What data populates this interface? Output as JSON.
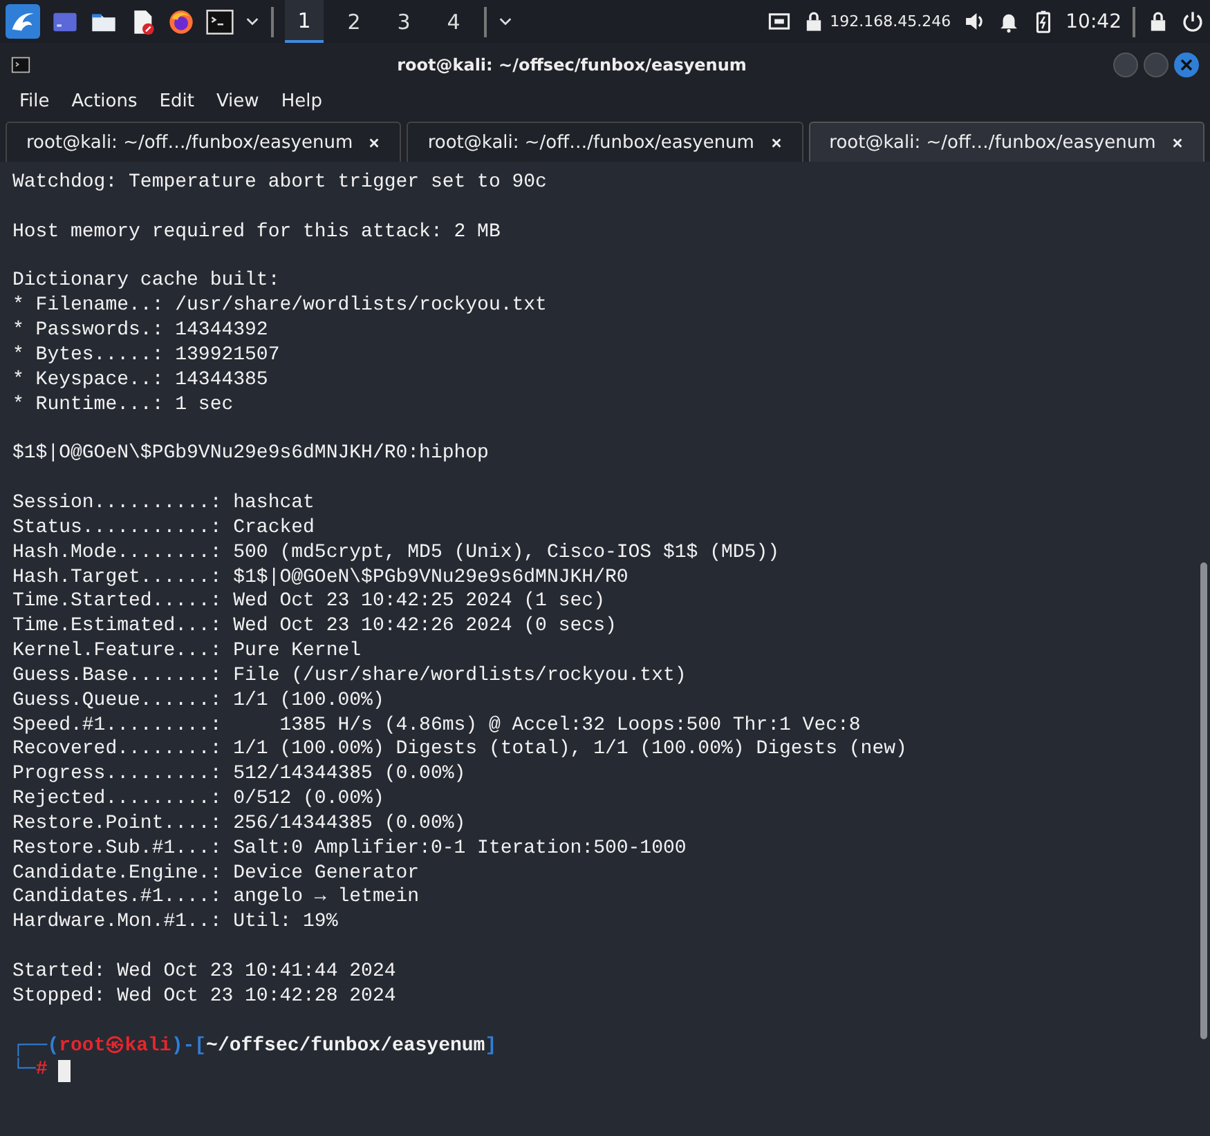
{
  "taskbar": {
    "launchers": [
      {
        "kind": "kali"
      },
      {
        "kind": "desktop"
      },
      {
        "kind": "folder"
      },
      {
        "kind": "editor"
      },
      {
        "kind": "browser"
      },
      {
        "kind": "terminal"
      },
      {
        "kind": "chevron"
      }
    ],
    "workspaces": [
      {
        "label": "1",
        "selected": true
      },
      {
        "label": "2",
        "selected": false
      },
      {
        "label": "3",
        "selected": false
      },
      {
        "label": "4",
        "selected": false
      }
    ],
    "ip": "192.168.45.246",
    "clock": "10:42"
  },
  "window": {
    "title": "root@kali: ~/offsec/funbox/easyenum"
  },
  "menu": [
    "File",
    "Actions",
    "Edit",
    "View",
    "Help"
  ],
  "tabs": [
    {
      "label": "root@kali: ~/off…/funbox/easyenum",
      "selected": false
    },
    {
      "label": "root@kali: ~/off…/funbox/easyenum",
      "selected": false
    },
    {
      "label": "root@kali: ~/off…/funbox/easyenum",
      "selected": true
    }
  ],
  "terminal": {
    "blocks": [
      [
        "Watchdog: Temperature abort trigger set to 90c"
      ],
      [
        "Host memory required for this attack: 2 MB"
      ],
      [
        "Dictionary cache built:",
        "* Filename..: /usr/share/wordlists/rockyou.txt",
        "* Passwords.: 14344392",
        "* Bytes.....: 139921507",
        "* Keyspace..: 14344385",
        "* Runtime...: 1 sec"
      ],
      [
        "$1$|O@GOeN\\$PGb9VNu29e9s6dMNJKH/R0:hiphop"
      ],
      [
        "Session..........: hashcat",
        "Status...........: Cracked",
        "Hash.Mode........: 500 (md5crypt, MD5 (Unix), Cisco-IOS $1$ (MD5))",
        "Hash.Target......: $1$|O@GOeN\\$PGb9VNu29e9s6dMNJKH/R0",
        "Time.Started.....: Wed Oct 23 10:42:25 2024 (1 sec)",
        "Time.Estimated...: Wed Oct 23 10:42:26 2024 (0 secs)",
        "Kernel.Feature...: Pure Kernel",
        "Guess.Base.......: File (/usr/share/wordlists/rockyou.txt)",
        "Guess.Queue......: 1/1 (100.00%)",
        "Speed.#1.........:     1385 H/s (4.86ms) @ Accel:32 Loops:500 Thr:1 Vec:8",
        "Recovered........: 1/1 (100.00%) Digests (total), 1/1 (100.00%) Digests (new)",
        "Progress.........: 512/14344385 (0.00%)",
        "Rejected.........: 0/512 (0.00%)",
        "Restore.Point....: 256/14344385 (0.00%)",
        "Restore.Sub.#1...: Salt:0 Amplifier:0-1 Iteration:500-1000",
        "Candidate.Engine.: Device Generator",
        "Candidates.#1....: angelo → letmein",
        "Hardware.Mon.#1..: Util: 19%"
      ],
      [
        "Started: Wed Oct 23 10:41:44 2024",
        "Stopped: Wed Oct 23 10:42:28 2024"
      ]
    ],
    "prompt": [
      [
        {
          "text": "┌──(",
          "kind": "frame"
        },
        {
          "text": "root㉿kali",
          "kind": "user"
        },
        {
          "text": ")-[",
          "kind": "frame"
        },
        {
          "text": "~/offsec/funbox/easyenum",
          "kind": "path"
        },
        {
          "text": "]",
          "kind": "frame"
        }
      ],
      [
        {
          "text": "└─",
          "kind": "frame"
        },
        {
          "text": "#",
          "kind": "user"
        }
      ]
    ]
  }
}
